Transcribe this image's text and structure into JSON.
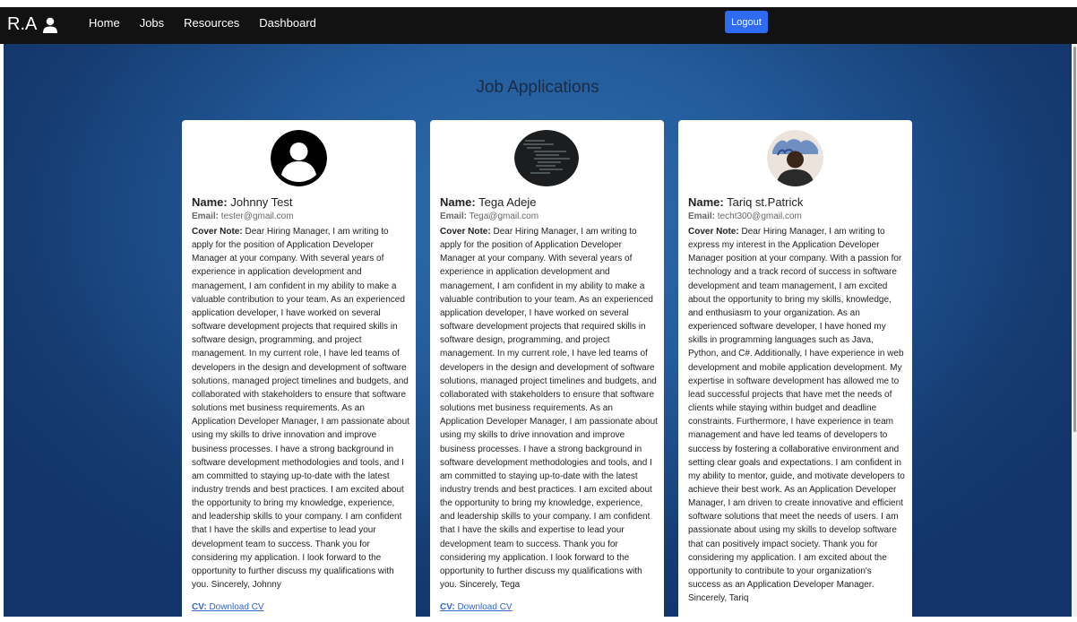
{
  "navbar": {
    "brand": "R.A",
    "links": [
      "Home",
      "Jobs",
      "Resources",
      "Dashboard"
    ],
    "logout_label": "Logout",
    "background": "#121212"
  },
  "page": {
    "title": "Job Applications"
  },
  "labels": {
    "name": "Name:",
    "email": "Email:",
    "cover": "Cover Note:",
    "cv": "CV:",
    "cv_link": "Download CV"
  },
  "applications": [
    {
      "name": "Johnny Test",
      "email": "tester@gmail.com",
      "avatar": "default-user-icon",
      "cover_note": "Dear Hiring Manager, I am writing to apply for the position of Application Developer Manager at your company. With several years of experience in application development and management, I am confident in my ability to make a valuable contribution to your team. As an experienced application developer, I have worked on several software development projects that required skills in software design, programming, and project management. In my current role, I have led teams of developers in the design and development of software solutions, managed project timelines and budgets, and collaborated with stakeholders to ensure that software solutions met business requirements. As an Application Developer Manager, I am passionate about using my skills to drive innovation and improve business processes. I have a strong background in software development methodologies and tools, and I am committed to staying up-to-date with the latest industry trends and best practices. I am excited about the opportunity to bring my knowledge, experience, and leadership skills to your company. I am confident that I have the skills and expertise to lead your development team to success. Thank you for considering my application. I look forward to the opportunity to further discuss my qualifications with you. Sincerely, Johnny"
    },
    {
      "name": "Tega Adeje",
      "email": "Tega@gmail.com",
      "avatar": "terminal-photo",
      "cover_note": "Dear Hiring Manager, I am writing to apply for the position of Application Developer Manager at your company. With several years of experience in application development and management, I am confident in my ability to make a valuable contribution to your team. As an experienced application developer, I have worked on several software development projects that required skills in software design, programming, and project management. In my current role, I have led teams of developers in the design and development of software solutions, managed project timelines and budgets, and collaborated with stakeholders to ensure that software solutions met business requirements. As an Application Developer Manager, I am passionate about using my skills to drive innovation and improve business processes. I have a strong background in software development methodologies and tools, and I am committed to staying up-to-date with the latest industry trends and best practices. I am excited about the opportunity to bring my knowledge, experience, and leadership skills to your company. I am confident that I have the skills and expertise to lead your development team to success. Thank you for considering my application. I look forward to the opportunity to further discuss my qualifications with you. Sincerely, Tega"
    },
    {
      "name": "Tariq st.Patrick",
      "email": "techt300@gmail.com",
      "avatar": "person-photo",
      "cover_note": "Dear Hiring Manager, I am writing to express my interest in the Application Developer Manager position at your company. With a passion for technology and a track record of success in software development and team management, I am excited about the opportunity to bring my skills, knowledge, and enthusiasm to your organization. As an experienced software developer, I have honed my skills in programming languages such as Java, Python, and C#. Additionally, I have experience in web development and mobile application development. My expertise in software development has allowed me to lead successful projects that have met the needs of clients while staying within budget and deadline constraints. Furthermore, I have experience in team management and have led teams of developers to success by fostering a collaborative environment and setting clear goals and expectations. I am confident in my ability to mentor, guide, and motivate developers to achieve their best work. As an Application Developer Manager, I am driven to create innovative and efficient software solutions that meet the needs of users. I am passionate about using my skills to develop software that can positively impact society. Thank you for considering my application. I am excited about the opportunity to contribute to your organization's success as an Application Developer Manager. Sincerely, Tariq"
    }
  ]
}
